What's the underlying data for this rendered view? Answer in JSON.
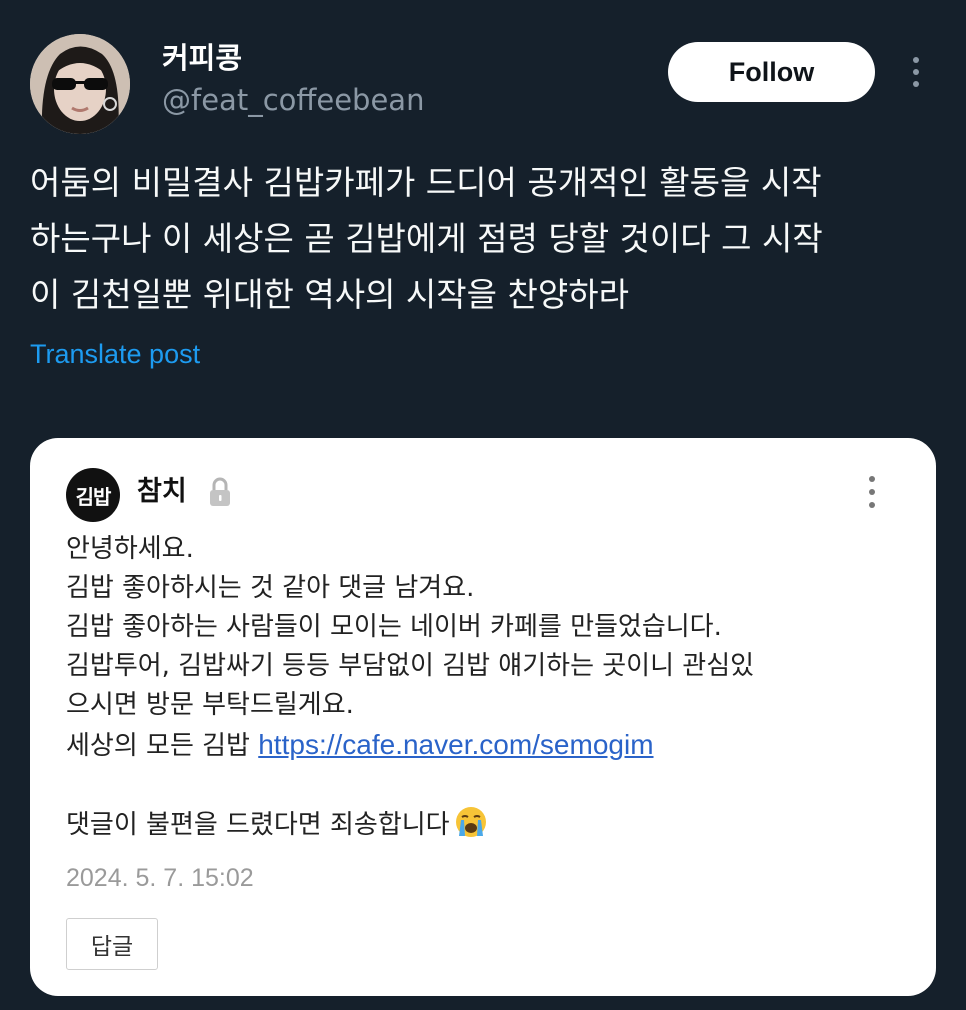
{
  "tweet": {
    "author": {
      "display_name": "커피콩",
      "handle": "@feat_coffeebean"
    },
    "follow_label": "Follow",
    "text_lines": [
      "어둠의 비밀결사 김밥카페가 드디어 공개적인 활동을 시작",
      "하는구나 이 세상은 곧 김밥에게 점령 당할 것이다 그 시작",
      "이 김천일뿐 위대한 역사의 시작을 찬양하라"
    ],
    "translate_label": "Translate post"
  },
  "comment": {
    "badge_text": "김밥",
    "author": "참치",
    "lines": [
      "안녕하세요.",
      "김밥 좋아하시는 것 같아 댓글 남겨요.",
      "김밥 좋아하는 사람들이 모이는 네이버 카페를 만들었습니다.",
      "김밥투어, 김밥싸기 등등 부담없이 김밥 얘기하는 곳이니 관심있",
      "으시면 방문 부탁드릴게요."
    ],
    "link_prefix": "세상의 모든 김밥 ",
    "link_text": "https://cafe.naver.com/semogim",
    "closing_text": "댓글이 불편을 드렸다면 죄송합니다",
    "closing_emoji": "loudly-crying-face-icon",
    "date": "2024. 5. 7. 15:02",
    "reply_label": "답글"
  },
  "colors": {
    "background": "#15202b",
    "link_blue": "#1d9bf0",
    "naver_link": "#2a63c9"
  }
}
